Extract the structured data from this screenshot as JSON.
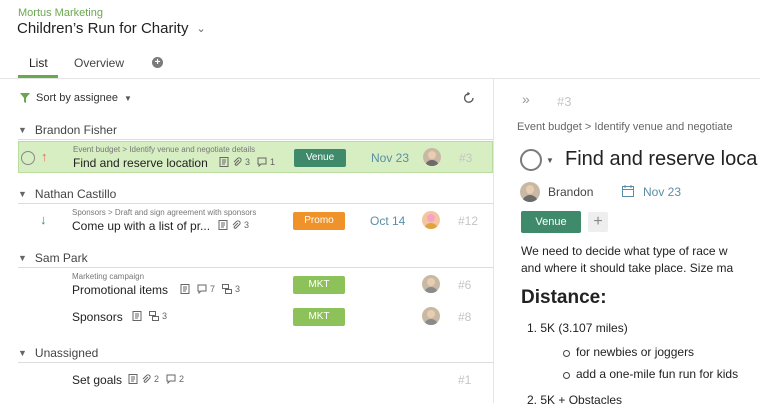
{
  "header": {
    "org": "Mortus Marketing",
    "project": "Children’s Run for Charity",
    "tabs": [
      {
        "label": "List",
        "active": true
      },
      {
        "label": "Overview",
        "active": false
      }
    ]
  },
  "list": {
    "sort_label": "Sort by assignee",
    "groups": [
      {
        "name": "Brandon Fisher"
      },
      {
        "name": "Nathan Castillo"
      },
      {
        "name": "Sam Park"
      },
      {
        "name": "Unassigned"
      }
    ],
    "rows": [
      {
        "crumb": "Event budget > Identify venue and negotiate details",
        "title": "Find and reserve location",
        "attachments": "3",
        "comments": "1",
        "tag": "Venue",
        "date": "Nov 23",
        "num": "#3",
        "arrow": "↑"
      },
      {
        "crumb": "Sponsors > Draft and sign agreement with sponsors",
        "title": "Come up with a list of pr...",
        "attachments": "3",
        "tag": "Promo",
        "date": "Oct 14",
        "num": "#12",
        "arrow": "↓"
      },
      {
        "crumb": "Marketing campaign",
        "title": "Promotional items",
        "comments": "7",
        "subtasks": "3",
        "tag": "MKT",
        "num": "#6"
      },
      {
        "title": "Sponsors",
        "subtasks": "3",
        "tag": "MKT",
        "num": "#8"
      },
      {
        "title": "Set goals",
        "attachments": "2",
        "comments": "2",
        "num": "#1"
      }
    ]
  },
  "detail": {
    "num": "#3",
    "crumb": "Event budget > Identify venue and negotiate",
    "title": "Find and reserve loca",
    "assignee": "Brandon",
    "date": "Nov 23",
    "tag": "Venue",
    "desc_line1": "We need to decide what type of race w",
    "desc_line2": "and where it should take place. Size ma",
    "heading": "Distance:",
    "item1": "1. 5K (3.107 miles)",
    "sub1": "for newbies or joggers",
    "sub2": "add a one-mile fun run for kids",
    "item2": "2. 5K + Obstacles"
  },
  "colors": {
    "accent": "#6aa84f",
    "venue": "#3f8a6a",
    "promo": "#f0922a",
    "mkt": "#8dc15a",
    "date": "#5b8ea6",
    "selected_row": "#d7eec3",
    "high_priority": "#e06666",
    "low_priority": "#3f8a6a"
  },
  "icons": [
    "filter-icon",
    "chevron-down-icon",
    "add-tab-icon",
    "refresh-icon",
    "description-icon",
    "attachment-icon",
    "comment-icon",
    "subtask-icon",
    "expand-icon",
    "calendar-icon"
  ]
}
